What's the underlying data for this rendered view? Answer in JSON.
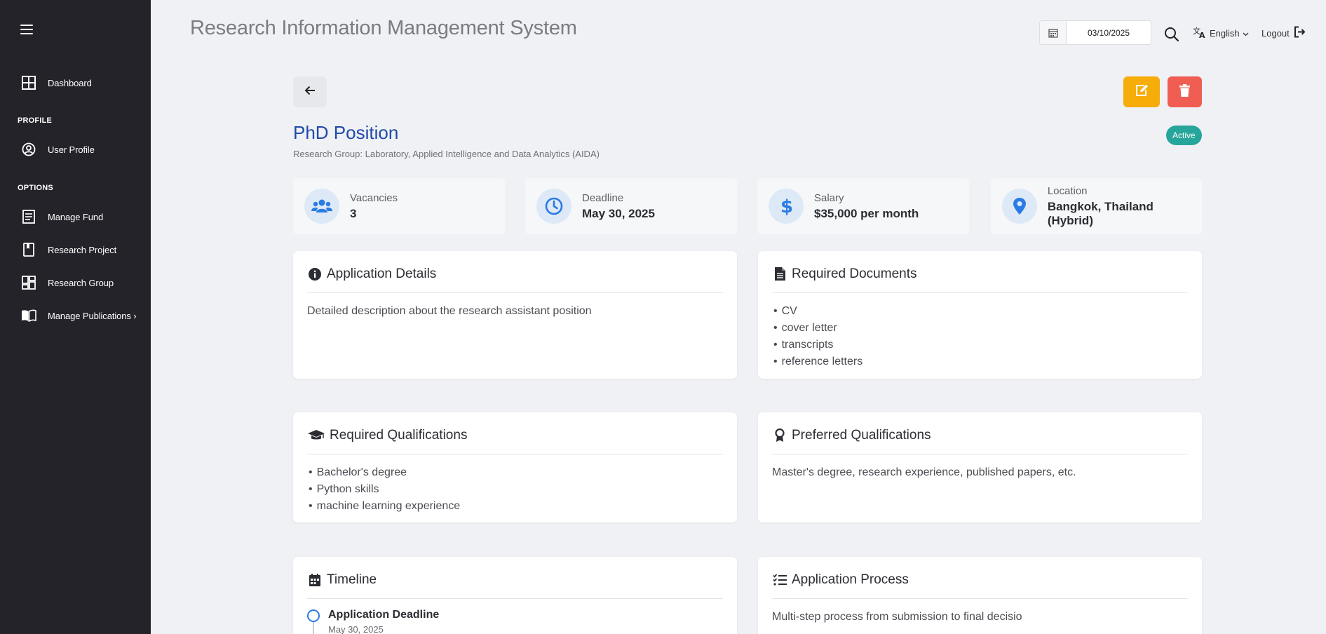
{
  "app": {
    "title": "Research Information Management System"
  },
  "topbar": {
    "date": "03/10/2025",
    "language": "English",
    "logout": "Logout"
  },
  "sidebar": {
    "dashboard": "Dashboard",
    "profile_section": "PROFILE",
    "user_profile": "User Profile",
    "options_section": "OPTIONS",
    "manage_fund": "Manage Fund",
    "research_project": "Research Project",
    "research_group": "Research Group",
    "manage_publications": "Manage Publications ›"
  },
  "position": {
    "title": "PhD Position",
    "research_group": "Research Group: Laboratory, Applied Intelligence and Data Analytics (AIDA)",
    "status": "Active"
  },
  "stats": {
    "vacancies": {
      "label": "Vacancies",
      "value": "3"
    },
    "deadline": {
      "label": "Deadline",
      "value": "May 30, 2025"
    },
    "salary": {
      "label": "Salary",
      "value": "$35,000 per month"
    },
    "location": {
      "label": "Location",
      "value": "Bangkok, Thailand (Hybrid)"
    }
  },
  "cards": {
    "application_details": {
      "title": "Application Details",
      "text": "Detailed description about the research assistant position"
    },
    "required_documents": {
      "title": "Required Documents",
      "items": [
        "CV",
        "cover letter",
        "transcripts",
        "reference letters"
      ]
    },
    "required_qualifications": {
      "title": "Required Qualifications",
      "items": [
        "Bachelor's degree",
        "Python skills",
        "machine learning experience"
      ]
    },
    "preferred_qualifications": {
      "title": "Preferred Qualifications",
      "text": "Master's degree, research experience, published papers, etc."
    },
    "timeline": {
      "title": "Timeline",
      "item_title": "Application Deadline",
      "item_date": "May 30, 2025"
    },
    "application_process": {
      "title": "Application Process",
      "text": "Multi-step process from submission to final decisio"
    }
  },
  "colors": {
    "sidebar_bg": "#232329",
    "title_blue": "#1f4aa8",
    "edit": "#f6ad0a",
    "delete": "#ef5d53",
    "active_badge": "#26a69a",
    "icon_blue": "#2a7be4"
  }
}
